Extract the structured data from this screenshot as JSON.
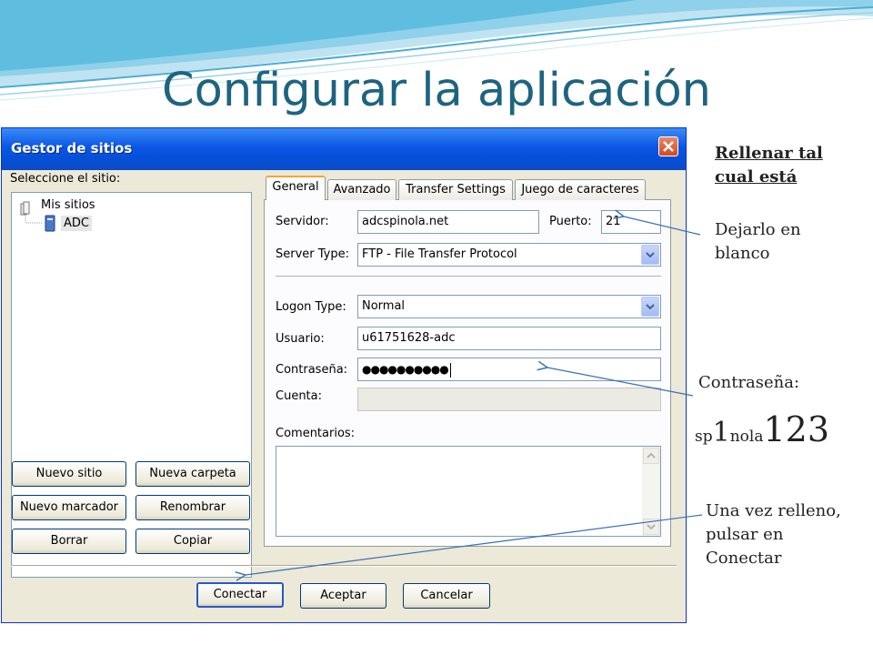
{
  "slide": {
    "title": "Configurar la aplicación"
  },
  "dialog": {
    "title": "Gestor de sitios",
    "close_icon": "close-icon",
    "site_label": "Seleccione el sitio:",
    "tree": {
      "root": "Mis sitios",
      "child": "ADC"
    },
    "left_buttons": {
      "new_site": "Nuevo sitio",
      "new_folder": "Nueva carpeta",
      "new_bookmark": "Nuevo marcador",
      "rename": "Renombrar",
      "delete": "Borrar",
      "copy": "Copiar"
    },
    "tabs": [
      "General",
      "Avanzado",
      "Transfer Settings",
      "Juego de caracteres"
    ],
    "active_tab": "General",
    "form": {
      "server_label": "Servidor:",
      "server_value": "adcspinola.net",
      "port_label": "Puerto:",
      "port_value": "21",
      "server_type_label": "Server Type:",
      "server_type_value": "FTP - File Transfer Protocol",
      "logon_type_label": "Logon Type:",
      "logon_type_value": "Normal",
      "user_label": "Usuario:",
      "user_value": "u61751628-adc",
      "password_label": "Contraseña:",
      "password_value": "●●●●●●●●●●",
      "account_label": "Cuenta:",
      "comments_label": "Comentarios:"
    },
    "bottom_buttons": {
      "connect": "Conectar",
      "accept": "Aceptar",
      "cancel": "Cancelar"
    }
  },
  "notes": {
    "heading": "Rellenar tal cual está",
    "port_note": "Dejarlo en blanco",
    "password_note_label": "Contraseña:",
    "password_parts": [
      "sp",
      "1",
      "nola",
      "123"
    ],
    "connect_note": "Una vez relleno, pulsar en Conectar"
  },
  "colors": {
    "title": "#1d6480",
    "xp_titlebar": "#0a56e6",
    "tab_highlight": "#f3a430",
    "arrow": "#3a6fb4"
  }
}
